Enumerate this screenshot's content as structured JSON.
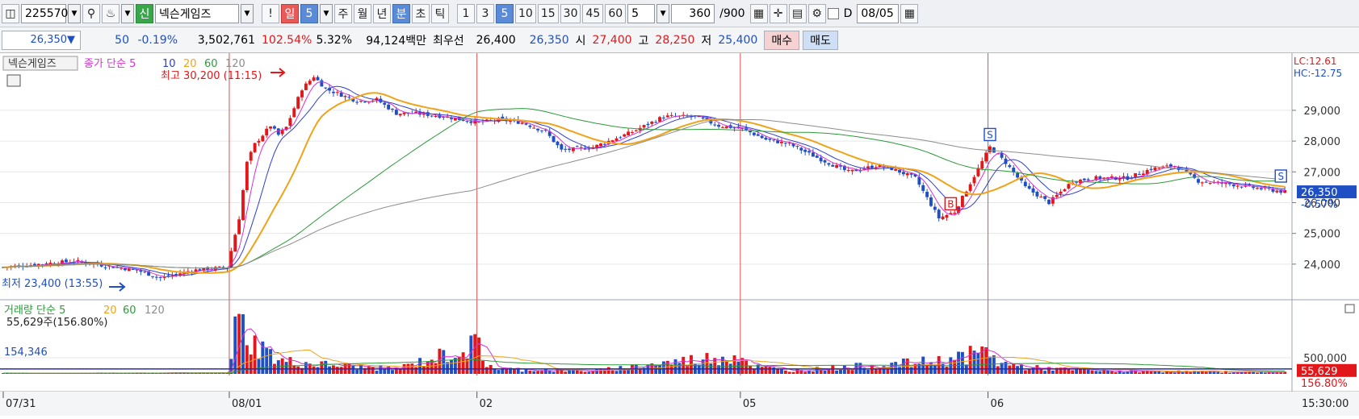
{
  "toolbar": {
    "code": "225570",
    "new_badge": "신",
    "stock_name": "넥슨게임즈",
    "exclaim": "!",
    "period_buttons": [
      "일",
      "5",
      "주",
      "월",
      "년",
      "분",
      "초",
      "틱"
    ],
    "interval_buttons": [
      "1",
      "3",
      "5",
      "10",
      "15",
      "30",
      "45",
      "60"
    ],
    "interval_value": "5",
    "count_value": "360",
    "count_total": "/900",
    "date_prefix": "D",
    "date_value": "08/05"
  },
  "quote": {
    "price": "26,350",
    "arrow": "▼",
    "change": "50",
    "change_pct": "-0.19%",
    "volume": "3,502,761",
    "vol_ratio": "102.54%",
    "turnover": "5.32%",
    "amount": "94,124백만",
    "best_label": "최우선",
    "best_ask": "26,400",
    "best_bid": "26,350",
    "open_label": "시",
    "open": "27,400",
    "high_label": "고",
    "high": "28,250",
    "low_label": "저",
    "low": "25,400",
    "buy_label": "매수",
    "sell_label": "매도"
  },
  "legend": {
    "name": "넥슨게임즈",
    "price_ma_label": "종가 단순 5",
    "ma_periods": [
      "10",
      "20",
      "60",
      "120"
    ],
    "high_marker": "최고 30,200 (11:15)",
    "low_marker": "최저 23,400 (13:55)",
    "lc": "LC:12.61",
    "hc": "HC:-12.75",
    "current_label": "26,350",
    "current_pct": "-0.57%",
    "volume_ma_label": "거래량  단순 5",
    "volume_ma_periods": [
      "20",
      "60",
      "120"
    ],
    "volume_value": "55,629주(156.80%)",
    "volume_line_label": "154,346",
    "volume_current": "55,629",
    "volume_current_pct": "156.80%"
  },
  "signals": [
    "S",
    "B",
    "S"
  ],
  "time_labels": [
    "07/31",
    "08/01",
    "02",
    "05",
    "06",
    "15:30:00"
  ],
  "colors": {
    "up": "#e2171a",
    "down": "#1f4fc4",
    "ma5": "#d531d5",
    "ma10": "#2f3fd0",
    "ma20": "#f0a318",
    "ma60": "#2e9a3c",
    "ma120": "#8d8d8d",
    "divider": "#e05050"
  },
  "chart_data": {
    "type": "candlestick",
    "price_axis": {
      "ticks": [
        24000,
        25000,
        26000,
        27000,
        28000,
        29000
      ],
      "ylim": [
        23000,
        30700
      ]
    },
    "volume_axis": {
      "ticks": [
        500000
      ],
      "ylim": [
        0,
        1900000
      ],
      "reference_line": 154346
    },
    "x_categories": [
      "07/31",
      "08/01",
      "02",
      "05",
      "06"
    ],
    "day_starts": [
      0,
      58,
      121,
      188,
      251
    ],
    "bar_count": 327,
    "anchors": [
      [
        0,
        23900
      ],
      [
        18,
        24100
      ],
      [
        34,
        23800
      ],
      [
        40,
        23550
      ],
      [
        48,
        23800
      ],
      [
        57,
        23900
      ],
      [
        60,
        25500
      ],
      [
        62,
        27300
      ],
      [
        64,
        27900
      ],
      [
        68,
        28500
      ],
      [
        70,
        28200
      ],
      [
        72,
        28450
      ],
      [
        76,
        29700
      ],
      [
        79,
        30100
      ],
      [
        82,
        29700
      ],
      [
        90,
        29300
      ],
      [
        95,
        29350
      ],
      [
        100,
        28900
      ],
      [
        105,
        28900
      ],
      [
        112,
        28800
      ],
      [
        121,
        28600
      ],
      [
        126,
        28700
      ],
      [
        132,
        28600
      ],
      [
        138,
        28300
      ],
      [
        142,
        27700
      ],
      [
        150,
        27800
      ],
      [
        160,
        28300
      ],
      [
        168,
        28800
      ],
      [
        176,
        28800
      ],
      [
        182,
        28500
      ],
      [
        188,
        28400
      ],
      [
        194,
        28050
      ],
      [
        200,
        27900
      ],
      [
        208,
        27400
      ],
      [
        215,
        27000
      ],
      [
        222,
        27200
      ],
      [
        226,
        27100
      ],
      [
        232,
        26800
      ],
      [
        238,
        25500
      ],
      [
        242,
        25700
      ],
      [
        245,
        26400
      ],
      [
        251,
        27800
      ],
      [
        255,
        27300
      ],
      [
        260,
        26500
      ],
      [
        266,
        26000
      ],
      [
        272,
        26700
      ],
      [
        278,
        26800
      ],
      [
        286,
        26800
      ],
      [
        292,
        27100
      ],
      [
        298,
        27200
      ],
      [
        304,
        26700
      ],
      [
        312,
        26600
      ],
      [
        320,
        26450
      ],
      [
        326,
        26350
      ]
    ],
    "volume_anchors": [
      [
        0,
        20000
      ],
      [
        57,
        30000
      ],
      [
        58,
        700000
      ],
      [
        59,
        1300000
      ],
      [
        60,
        1600000
      ],
      [
        62,
        1300000
      ],
      [
        64,
        900000
      ],
      [
        66,
        800000
      ],
      [
        70,
        400000
      ],
      [
        80,
        300000
      ],
      [
        100,
        150000
      ],
      [
        121,
        900000
      ],
      [
        122,
        400000
      ],
      [
        126,
        150000
      ],
      [
        150,
        90000
      ],
      [
        188,
        600000
      ],
      [
        190,
        250000
      ],
      [
        200,
        100000
      ],
      [
        233,
        350000
      ],
      [
        238,
        400000
      ],
      [
        251,
        700000
      ],
      [
        253,
        350000
      ],
      [
        260,
        200000
      ],
      [
        280,
        90000
      ],
      [
        326,
        55629
      ]
    ],
    "high": {
      "value": 30200,
      "time": "11:15"
    },
    "low": {
      "value": 23400,
      "time": "13:55"
    }
  }
}
